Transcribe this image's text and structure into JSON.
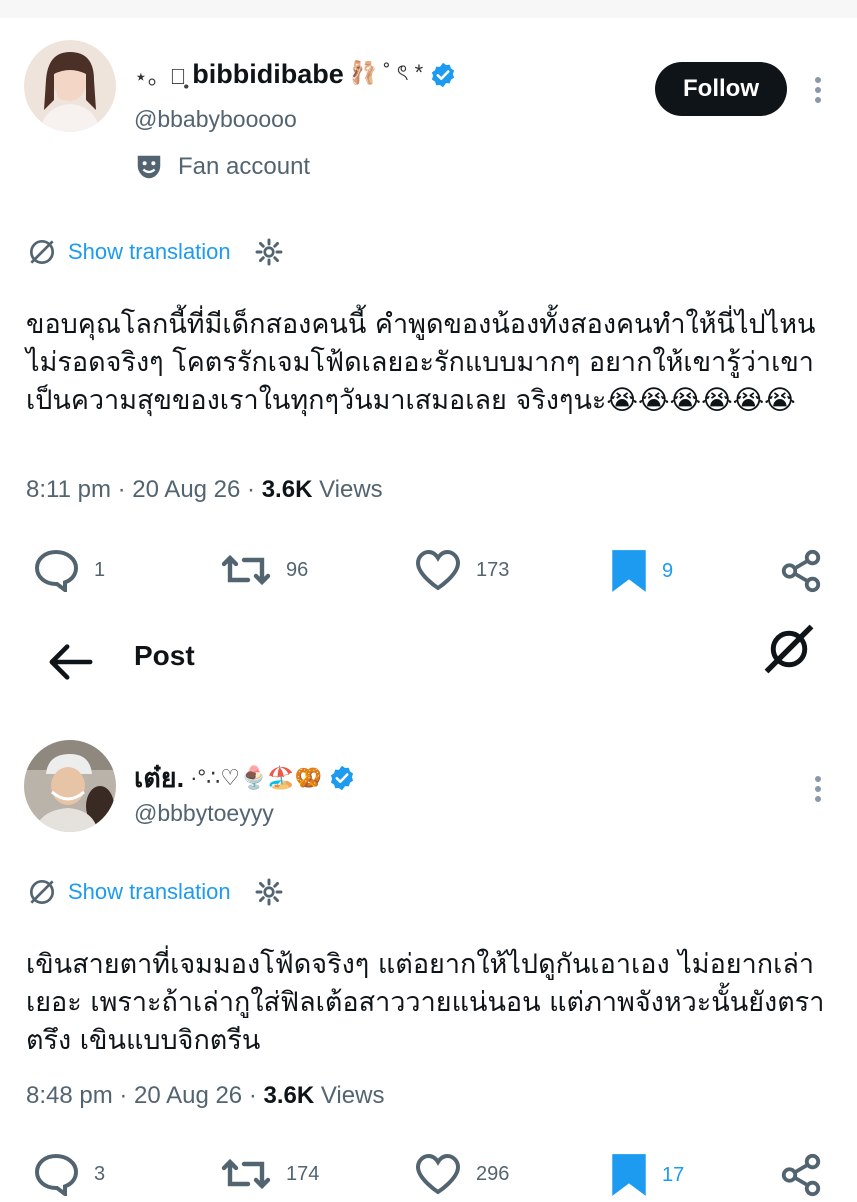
{
  "tweet1": {
    "display_name": "bibbidibabe",
    "name_prefix_deco": "⋆。✿̥͙",
    "name_suffix_deco": "🩰 ˚ ৎ *",
    "handle": "@bbabybooooo",
    "fan_label": "Fan account",
    "follow_label": "Follow",
    "translate_label": "Show translation",
    "text": "ขอบคุณโลกนี้ที่มีเด็กสองคนนี้ คำพูดของน้องทั้งสองคนทำให้นี่ไปไหนไม่รอดจริงๆ โคตรรักเจมโฟ้ดเลยอะรักแบบมากๆ อยากให้เขารู้ว่าเขาเป็นความสุขของเราในทุกๆวันมาเสมอเลย จริงๆนะ😭😭😭😭😭😭",
    "time": "8:11 pm",
    "date": "20 Aug 26",
    "views_count": "3.6K",
    "views_label": "Views",
    "replies": "1",
    "reposts": "96",
    "likes": "173",
    "bookmarks": "9"
  },
  "postbar": {
    "title": "Post"
  },
  "tweet2": {
    "display_name": "เต๋ย.",
    "name_suffix_deco": "·°∴♡🍨🏖️🥨",
    "handle": "@bbbytoeyyy",
    "translate_label": "Show translation",
    "text": "เขินสายตาที่เจมมองโฟ้ดจริงๆ แต่อยากให้ไปดูกันเอาเอง ไม่อยากเล่าเยอะ เพราะถ้าเล่ากูใส่ฟิลเต้อสาววายแน่นอน แต่ภาพจังหวะนั้นยังตราตรึง เขินแบบจิกตรีน",
    "time": "8:48 pm",
    "date": "20 Aug 26",
    "views_count": "3.6K",
    "views_label": "Views",
    "replies": "3",
    "reposts": "174",
    "likes": "296",
    "bookmarks": "17"
  },
  "colors": {
    "accent_blue": "#1d9bf0",
    "text_primary": "#0f1419",
    "text_secondary": "#536471",
    "follow_bg": "#0f1419"
  }
}
